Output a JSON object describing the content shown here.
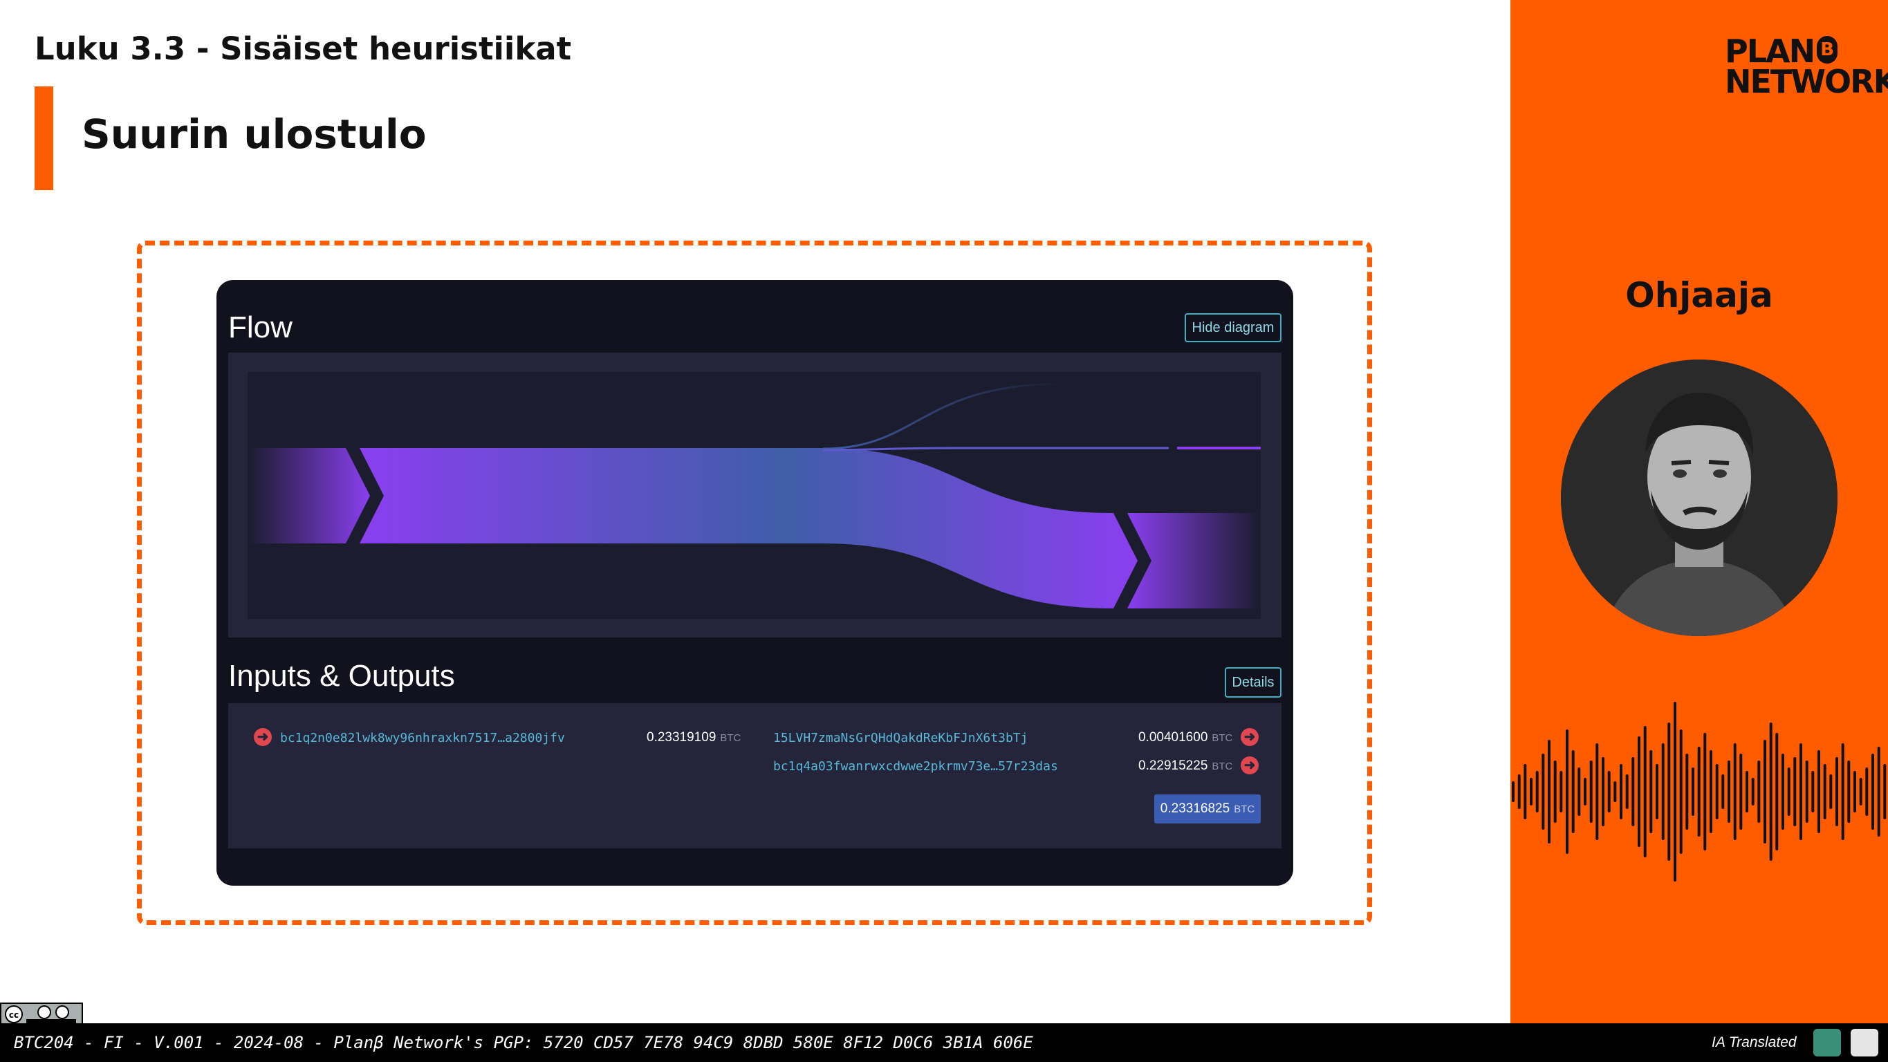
{
  "slide": {
    "chapter": "Luku 3.3 - Sisäiset heuristiikat",
    "title": "Suurin ulostulo"
  },
  "app": {
    "flow_title": "Flow",
    "hide_diagram_label": "Hide diagram",
    "io_title": "Inputs & Outputs",
    "details_label": "Details",
    "inputs": [
      {
        "address": "bc1q2n0e82lwk8wy96nhraxkn7517…a2800jfv",
        "amount": "0.23319109",
        "unit": "BTC"
      }
    ],
    "outputs": [
      {
        "address": "15LVH7zmaNsGrQHdQakdReKbFJnX6t3bTj",
        "amount": "0.00401600",
        "unit": "BTC"
      },
      {
        "address": "bc1q4a03fwanrwxcdwwe2pkrmv73e…57r23das",
        "amount": "0.22915225",
        "unit": "BTC"
      }
    ],
    "total": {
      "amount": "0.23316825",
      "unit": "BTC"
    }
  },
  "sidebar": {
    "logo_line1": "PLAN",
    "logo_b": "B",
    "logo_line2": "NETWORK",
    "instructor_label": "Ohjaaja"
  },
  "footer": {
    "text": "BTC204 - FI - V.001 - 2024-08 - Planβ Network's PGP: 5720 CD57 7E78 94C9 8DBD 580E 8F12 D0C6 3B1A 606E",
    "right": "IA Translated",
    "license": "CC BY SA"
  },
  "colors": {
    "accent": "#ff5c00",
    "app_bg": "#11121e",
    "panel_bg": "#24253a",
    "flow_purple": "#8a3ff0",
    "flow_blue": "#3f5ea8",
    "address_blue": "#58b8d8",
    "arrow_red": "#e0474f",
    "total_badge": "#3a5db3"
  },
  "icons": [
    "arrow-right-icon",
    "cc-license-icon",
    "chatgpt-icon",
    "translator-icon",
    "audio-waveform-icon"
  ]
}
